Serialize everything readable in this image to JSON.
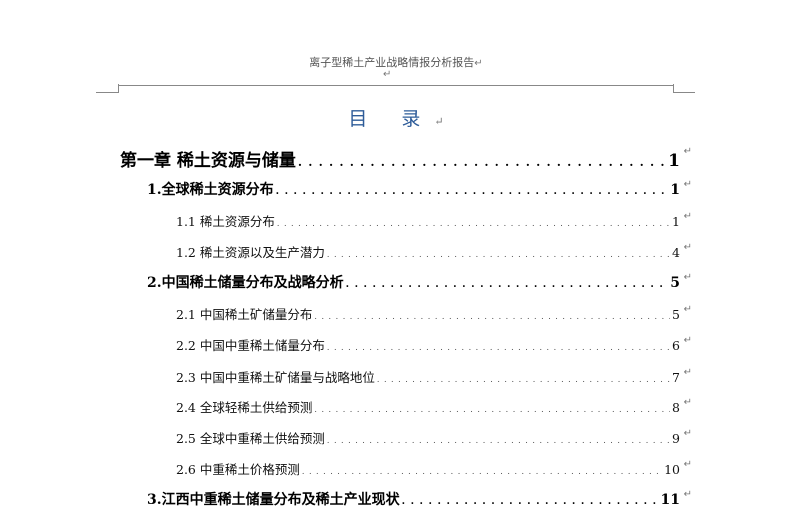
{
  "header": {
    "text": "离子型稀土产业战略情报分析报告",
    "para_mark": "↵"
  },
  "below_rule_mark": "↵",
  "toc_title": {
    "text": "目 录",
    "para_mark": "↵"
  },
  "toc": [
    {
      "level": 0,
      "text": "第一章  稀土资源与储量",
      "page": "1"
    },
    {
      "level": 1,
      "text": "1.全球稀土资源分布",
      "page": "1"
    },
    {
      "level": 2,
      "text": "1.1 稀土资源分布",
      "page": "1"
    },
    {
      "level": 2,
      "text": "1.2 稀土资源以及生产潜力",
      "page": "4"
    },
    {
      "level": 1,
      "text": "2.中国稀土储量分布及战略分析",
      "page": "5"
    },
    {
      "level": 2,
      "text": "2.1 中国稀土矿储量分布",
      "page": "5"
    },
    {
      "level": 2,
      "text": "2.2 中国中重稀土储量分布",
      "page": "6"
    },
    {
      "level": 2,
      "text": "2.3 中国中重稀土矿储量与战略地位",
      "page": "7"
    },
    {
      "level": 2,
      "text": "2.4 全球轻稀土供给预测",
      "page": "8"
    },
    {
      "level": 2,
      "text": "2.5 全球中重稀土供给预测",
      "page": "9"
    },
    {
      "level": 2,
      "text": "2.6 中重稀土价格预测",
      "page": "10"
    },
    {
      "level": 1,
      "text": "3.江西中重稀土储量分布及稀土产业现状",
      "page": "11"
    }
  ],
  "para_mark": "↵"
}
